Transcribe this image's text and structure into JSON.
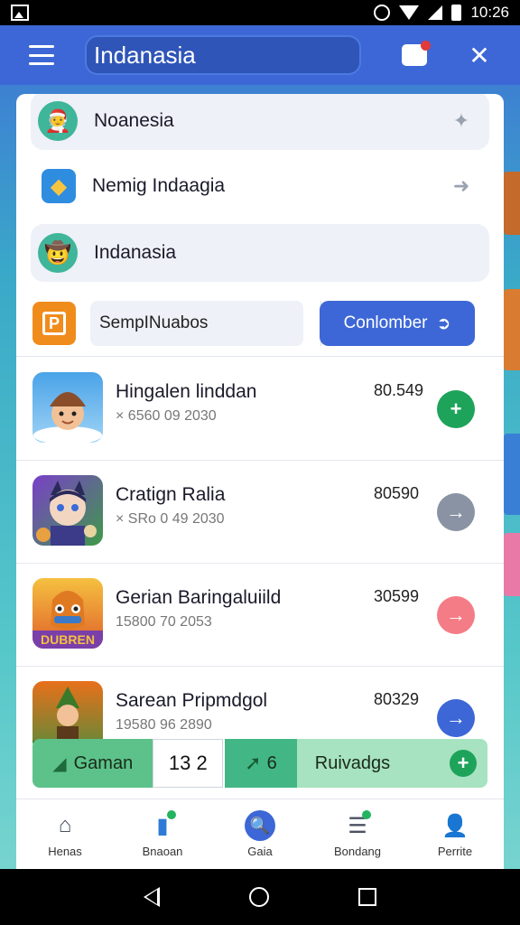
{
  "status_bar": {
    "time": "10:26"
  },
  "app_bar": {
    "search_text": "Indanasia"
  },
  "top_rows": [
    {
      "label": "Noanesia",
      "avatar": "🧑‍🎄",
      "avatar_bg": "#3fb59a"
    },
    {
      "label": "Nemig Indaagia",
      "avatar": "◆",
      "avatar_bg": "#2f8de0"
    },
    {
      "label": "Indanasia",
      "avatar": "🤠",
      "avatar_bg": "#3fb59a"
    }
  ],
  "search_row": {
    "logo_text": "P",
    "field_value": "SempINuabos",
    "arrow": "→",
    "confirm_label": "Conlomber"
  },
  "list": [
    {
      "title": "Hingalen linddan",
      "sub": "× 6560 09 2030",
      "num": "80.549",
      "action": "+",
      "action_color": "#1ea35b",
      "icon_bg": "#4aa3e8"
    },
    {
      "title": "Cratign Ralia",
      "sub": "× SRo 0 49 2030",
      "num": "80590",
      "action": "→",
      "action_color": "#8a93a3",
      "icon_bg": "#6b45b8"
    },
    {
      "title": "Gerian Baringaluiild",
      "sub": "15800 70 2053",
      "num": "30599",
      "action": "→",
      "action_color": "#f47c86",
      "icon_bg": "#f09a2a"
    },
    {
      "title": "Sarean Pripmdgol",
      "sub": "19580 96 2890",
      "num": "80329",
      "action": "→",
      "action_color": "#3d67d6",
      "icon_bg": "#5b8a3a"
    }
  ],
  "float_bar": {
    "game_label": "Gaman",
    "count": "13 2",
    "six_label": "6",
    "reward_label": "Ruivadgs",
    "plus": "+"
  },
  "bottom_nav": [
    {
      "label": "Henas",
      "icon": "⌂"
    },
    {
      "label": "Bnaoan",
      "icon": "▮"
    },
    {
      "label": "Gaia",
      "icon": "🔍"
    },
    {
      "label": "Bondang",
      "icon": "☰"
    },
    {
      "label": "Perrite",
      "icon": "👤"
    }
  ]
}
